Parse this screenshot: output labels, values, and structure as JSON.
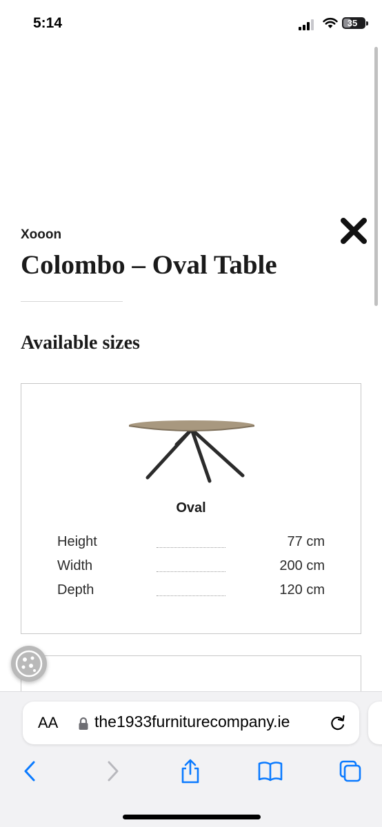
{
  "status_bar": {
    "time": "5:14",
    "battery_level": "35",
    "battery_fraction": 0.35,
    "signal_bars_active": 3,
    "signal_bars_total": 4
  },
  "content": {
    "brand": "Xooon",
    "title": "Colombo – Oval Table",
    "close_icon": "close-icon",
    "section_heading": "Available sizes",
    "sizes": [
      {
        "name": "Oval",
        "dimensions": [
          {
            "label": "Height",
            "value": "77 cm"
          },
          {
            "label": "Width",
            "value": "200 cm"
          },
          {
            "label": "Depth",
            "value": "120 cm"
          }
        ]
      }
    ]
  },
  "browser": {
    "reader_label": "AA",
    "url": "the1933furniturecompany.ie",
    "icons": {
      "back": "chevron-left-icon",
      "forward": "chevron-right-icon",
      "share": "share-icon",
      "bookmarks": "book-icon",
      "tabs": "tabs-icon"
    }
  },
  "colors": {
    "accent": "#0a7aff",
    "disabled": "#b8b8bd",
    "text": "#1a1a1a"
  }
}
